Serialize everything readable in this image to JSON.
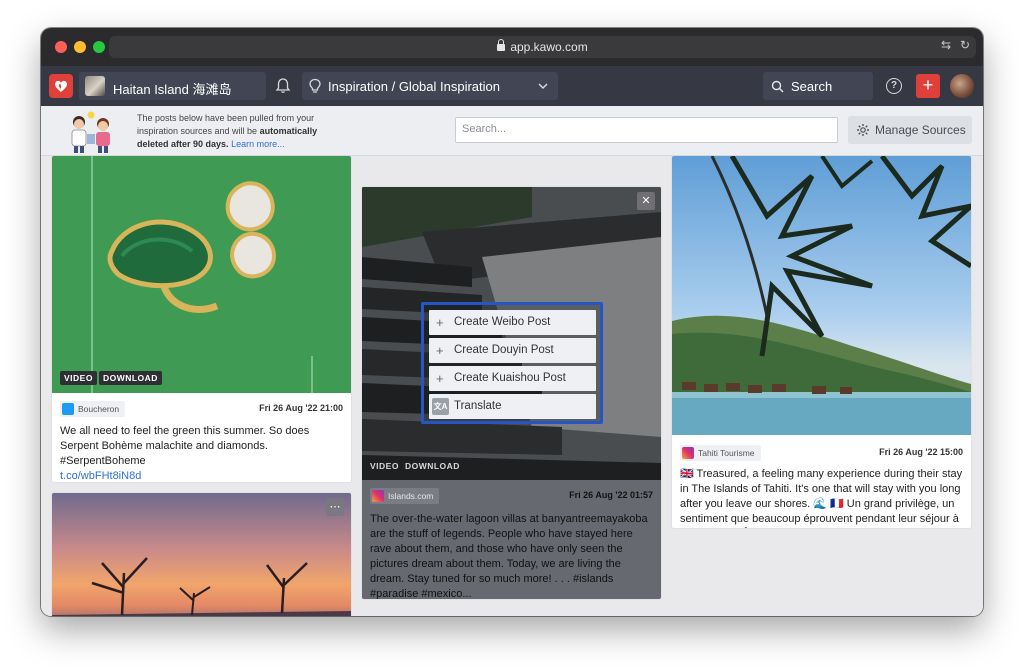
{
  "browser": {
    "url": "app.kawo.com"
  },
  "nav": {
    "account_name": "Haitan Island 海滩岛",
    "workspace_label": "Inspiration / Global Inspiration",
    "search_label": "Search",
    "add_label": "+",
    "help_label": "?"
  },
  "infobar": {
    "text_part1": "The posts below have been pulled from your inspiration sources and will be ",
    "text_bold": "automatically deleted after 90 days.",
    "learn_more": "Learn more...",
    "search_placeholder": "Search...",
    "manage_label": "Manage Sources"
  },
  "posts": [
    {
      "source": "Boucheron",
      "platform": "twitter-icon",
      "date": "Fri 26 Aug '22 21:00",
      "badges": [
        "VIDEO",
        "DOWNLOAD"
      ],
      "caption": "We all need to feel the green this summer. So does Serpent Bohème malachite and diamonds. #SerpentBoheme",
      "link": "t.co/wbFHt8iN8d"
    },
    {
      "source": "Islands.com",
      "platform": "instagram-icon",
      "date": "Fri 26 Aug '22 01:57",
      "badges": [
        "VIDEO",
        "DOWNLOAD"
      ],
      "caption": "The over-the-water lagoon villas at banyantreemayakoba are the stuff of legends. People who have stayed here rave about them, and those who have only seen the pictures dream about them. Today, we are living the dream. Stay tuned for so much more! . . . #islands #paradise #mexico..."
    },
    {
      "source": "Tahiti Tourisme",
      "platform": "instagram-icon",
      "date": "Fri 26 Aug '22 15:00",
      "caption": "🇬🇧 Treasured, a feeling many experience during their stay in The Islands of Tahiti. It's one that will stay with you long after you leave our shores. 🌊 🇫🇷 Un grand privilège, un sentiment que beaucoup éprouvent pendant leur séjour à Tahiti Et Ses Îles. C'est un sentiment qui..."
    }
  ],
  "context_menu": {
    "items": [
      "Create Weibo Post",
      "Create Douyin Post",
      "Create Kuaishou Post",
      "Translate"
    ]
  },
  "colors": {
    "nav_bg": "#363944",
    "accent": "#e0403a",
    "highlight_border": "#2457c5",
    "link": "#2d6fd6"
  }
}
